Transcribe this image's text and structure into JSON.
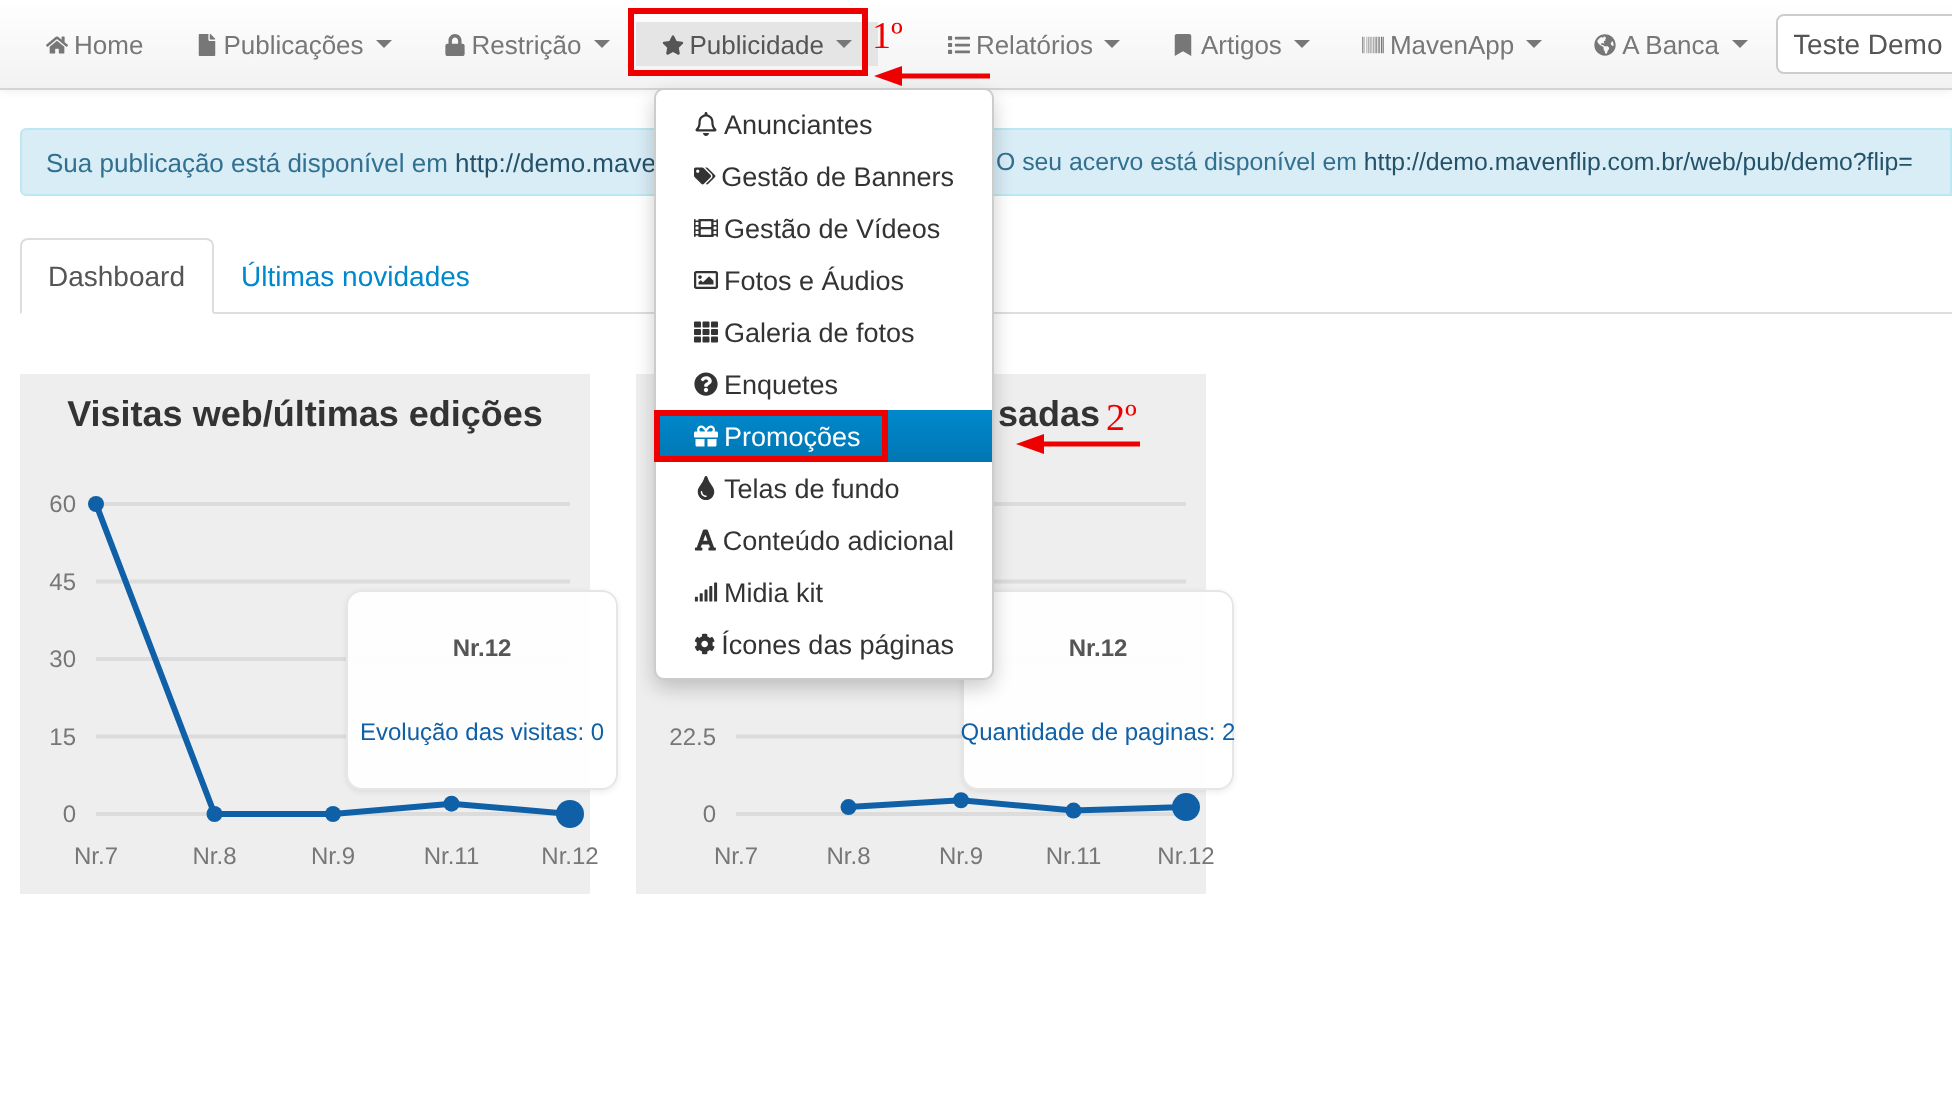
{
  "navbar": {
    "items": [
      {
        "label": "Home",
        "dropdown": false,
        "selected": false
      },
      {
        "label": "Publicações",
        "dropdown": true,
        "selected": false
      },
      {
        "label": "Restrição",
        "dropdown": true,
        "selected": false
      },
      {
        "label": "Publicidade",
        "dropdown": true,
        "selected": true
      },
      {
        "label": "Relatórios",
        "dropdown": true,
        "selected": false
      },
      {
        "label": "Artigos",
        "dropdown": true,
        "selected": false
      },
      {
        "label": "MavenApp",
        "dropdown": true,
        "selected": false
      },
      {
        "label": "A Banca",
        "dropdown": true,
        "selected": false
      }
    ],
    "user_field": {
      "value": "Teste Demo"
    }
  },
  "dropdown_menu": {
    "items": [
      {
        "label": "Anunciantes",
        "selected": false
      },
      {
        "label": "Gestão de Banners",
        "selected": false
      },
      {
        "label": "Gestão de Vídeos",
        "selected": false
      },
      {
        "label": "Fotos e Áudios",
        "selected": false
      },
      {
        "label": "Galeria de fotos",
        "selected": false
      },
      {
        "label": "Enquetes",
        "selected": false
      },
      {
        "label": "Promoções",
        "selected": true
      },
      {
        "label": "Telas de fundo",
        "selected": false
      },
      {
        "label": "Conteúdo adicional",
        "selected": false
      },
      {
        "label": "Midia kit",
        "selected": false
      },
      {
        "label": "Ícones das páginas",
        "selected": false
      }
    ]
  },
  "annotations": [
    {
      "text": "1º"
    },
    {
      "text": "2º"
    }
  ],
  "alert": {
    "parts": [
      {
        "text": "Sua publicação está disponível em",
        "link": "http://demo.mave"
      },
      {
        "text": "O seu acervo está disponível em",
        "link": "http://demo.mavenflip.com.br/web/pub/demo?flip="
      }
    ]
  },
  "tabs": [
    {
      "label": "Dashboard",
      "selected": true
    },
    {
      "label": "Últimas novidades",
      "selected": false
    }
  ],
  "panels": [
    {
      "title": "Visitas web/últimas edições",
      "cut": false,
      "chart_data": {
        "type": "line",
        "grid": true,
        "categories": [
          "Nr.7",
          "Nr.8",
          "Nr.9",
          "Nr.11",
          "Nr.12"
        ],
        "ylim": [
          0,
          60
        ],
        "yticks": [
          0,
          15,
          30,
          45,
          60
        ],
        "series": [
          {
            "color": "#1060a8",
            "marker": "circle",
            "values": [
              60,
              0,
              0,
              2,
              0
            ]
          }
        ]
      },
      "tooltip": {
        "title": "Nr.12",
        "label": "Evolução das visitas: 0"
      }
    },
    {
      "title": "sadas",
      "cut": true,
      "chart_data": {
        "type": "line",
        "grid": true,
        "categories": [
          "Nr.7",
          "Nr.8",
          "Nr.9",
          "Nr.11",
          "Nr.12"
        ],
        "ylim": [
          0,
          90
        ],
        "yticks": [
          0,
          {
            "value": 22.5,
            "label": "22.5"
          }
        ],
        "series": [
          {
            "color": "#1060a8",
            "marker": "circle",
            "values": [
              null,
              2,
              4,
              1,
              2
            ]
          }
        ]
      },
      "tooltip": {
        "title": "Nr.12",
        "label": "Quantidade de paginas: 2"
      }
    }
  ]
}
